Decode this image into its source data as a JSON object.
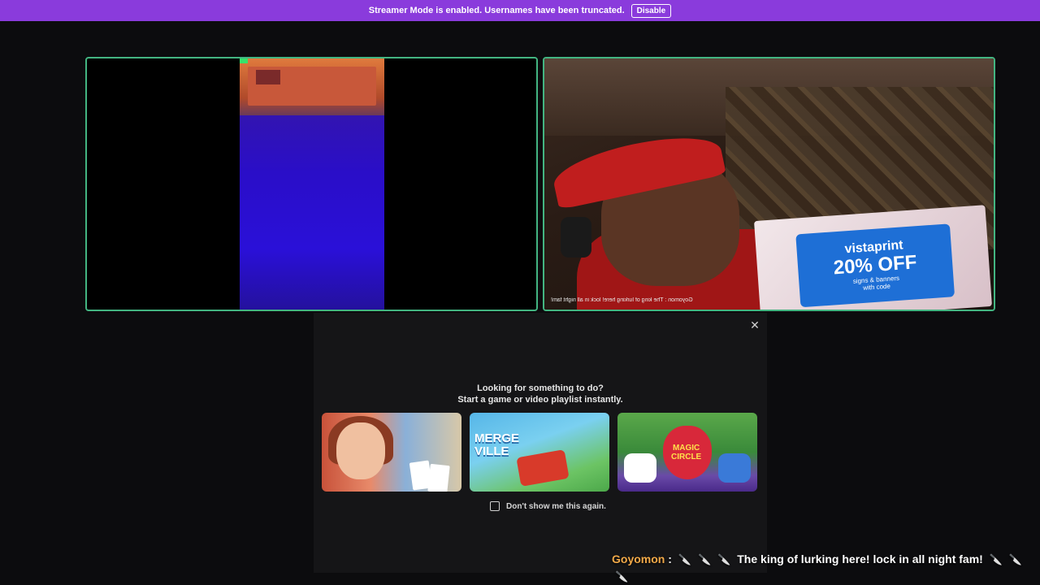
{
  "banner": {
    "text": "Streamer Mode is enabled. Usernames have been truncated.",
    "button_label": "Disable"
  },
  "stream": {
    "promo_brand": "vistaprint",
    "promo_offer": "20% OFF",
    "promo_sub1": "signs & banners",
    "promo_sub2": "with code"
  },
  "popup": {
    "close_label": "✕",
    "title_line1": "Looking for something to do?",
    "title_line2": "Start a game or video playlist instantly.",
    "card2_logo_line1": "MERGE",
    "card2_logo_line2": "VILLE",
    "card3_logo_line1": "MAGIC",
    "card3_logo_line2": "CIRCLE",
    "checkbox_label": "Don't show me this again."
  },
  "chat": {
    "username": "Goyomon",
    "separator": " :",
    "emote": "🔪",
    "message": "The king of lurking here! lock in all night fam!"
  },
  "colors": {
    "banner": "#8a3bdc",
    "speaking_border": "#43b581",
    "username": "#f2a948"
  }
}
